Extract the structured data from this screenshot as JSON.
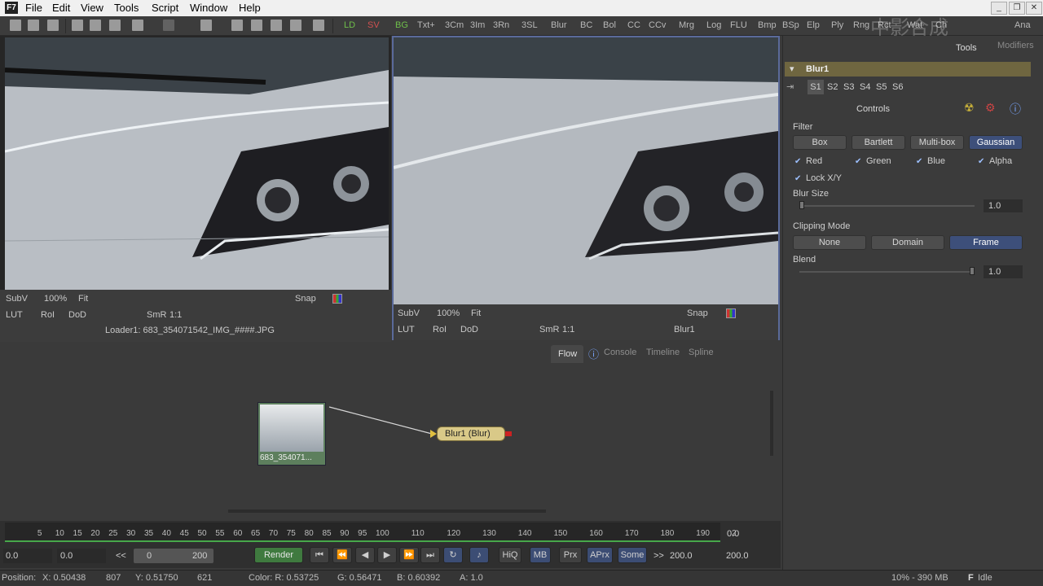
{
  "menu": {
    "app_icon": "F7",
    "items": [
      "File",
      "Edit",
      "View",
      "Tools",
      "Script",
      "Window",
      "Help"
    ]
  },
  "toolbar": {
    "labels": [
      "LD",
      "SV",
      "BG",
      "Txt+",
      "3Cm",
      "3Im",
      "3Rn",
      "3SL",
      "Blur",
      "BC",
      "Bol",
      "CC",
      "CCv",
      "Mrg",
      "Log",
      "FLU",
      "Bmp",
      "BSp",
      "Elp",
      "Ply",
      "Rng",
      "Rct",
      "Wat",
      "Ch",
      "Ana"
    ],
    "ld_color": "#6fbf4a",
    "sv_color": "#d05050",
    "bg_color": "#6fbf4a"
  },
  "watermark": "中影合成",
  "viewer_left": {
    "subv": "SubV",
    "zoom": "100%",
    "fit": "Fit",
    "snap": "Snap",
    "lut": "LUT",
    "roi": "RoI",
    "dod": "DoD",
    "smr": "SmR",
    "ratio": "1:1",
    "caption": "Loader1: 683_354071542_IMG_####.JPG"
  },
  "viewer_right": {
    "subv": "SubV",
    "zoom": "100%",
    "fit": "Fit",
    "snap": "Snap",
    "lut": "LUT",
    "roi": "RoI",
    "dod": "DoD",
    "smr": "SmR",
    "ratio": "1:1",
    "caption": "Blur1"
  },
  "panel": {
    "tabs": [
      "Tools",
      "Modifiers"
    ],
    "tool_name": "Blur1",
    "slots": [
      "S1",
      "S2",
      "S3",
      "S4",
      "S5",
      "S6"
    ],
    "controls_label": "Controls",
    "filter_label": "Filter",
    "filters": [
      "Box",
      "Bartlett",
      "Multi-box",
      "Gaussian"
    ],
    "channels": [
      "Red",
      "Green",
      "Blue",
      "Alpha"
    ],
    "lock": "Lock X/Y",
    "blur_size_label": "Blur Size",
    "blur_size": "1.0",
    "clip_label": "Clipping Mode",
    "clip_modes": [
      "None",
      "Domain",
      "Frame"
    ],
    "blend_label": "Blend",
    "blend": "1.0",
    "blur_size_fraction": 0.0,
    "blend_fraction": 1.0
  },
  "flow": {
    "tabs": [
      "Flow",
      "Console",
      "Timeline",
      "Spline"
    ],
    "loader_label": "683_354071...",
    "blur_label": "Blur1 (Blur)"
  },
  "timeline": {
    "ticks": [
      "5",
      "10",
      "15",
      "20",
      "25",
      "30",
      "35",
      "40",
      "45",
      "50",
      "55",
      "60",
      "65",
      "70",
      "75",
      "80",
      "85",
      "90",
      "95",
      "100",
      "110",
      "120",
      "130",
      "140",
      "150",
      "160",
      "170",
      "180",
      "190",
      "2"
    ],
    "current": "0.0",
    "start": "0.0",
    "render_start": "0.0",
    "range_start": "0",
    "range_end": "200",
    "render": "Render",
    "hiq": "HiQ",
    "mb": "MB",
    "prx": "Prx",
    "aprx": "APrx",
    "some": "Some",
    "end1": "200.0",
    "end2": "200.0",
    "prev_label": "<<",
    "next_label": ">>"
  },
  "status": {
    "position": "Position:",
    "x": "X: 0.50438",
    "px": "807",
    "y": "Y: 0.51750",
    "py": "621",
    "color": "Color: R: 0.53725",
    "g": "G: 0.56471",
    "b": "B: 0.60392",
    "a": "A: 1.0",
    "memory": "10% - 390 MB",
    "state": "Idle"
  }
}
